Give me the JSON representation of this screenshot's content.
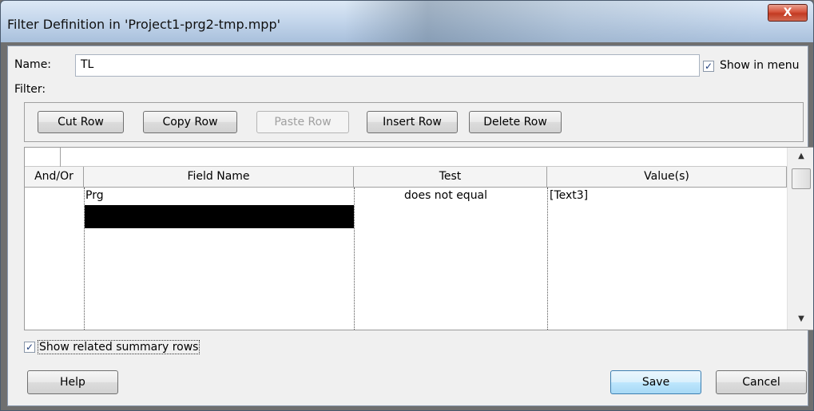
{
  "window": {
    "title": "Filter Definition in 'Project1-prg2-tmp.mpp'",
    "close_glyph": "X"
  },
  "name_field": {
    "label": "Name:",
    "value": "TL"
  },
  "show_in_menu": {
    "label": "Show in menu",
    "checked": true
  },
  "filter_label": "Filter:",
  "toolbar": {
    "cut_row": "Cut Row",
    "copy_row": "Copy Row",
    "paste_row": "Paste Row",
    "insert_row": "Insert Row",
    "delete_row": "Delete Row"
  },
  "grid": {
    "columns": [
      "And/Or",
      "Field Name",
      "Test",
      "Value(s)"
    ],
    "rows": [
      {
        "and_or": "",
        "field_name": "Prg",
        "test": "does not equal",
        "values": "[Text3]"
      }
    ]
  },
  "show_summary_rows": {
    "label": "Show related summary rows",
    "checked": true
  },
  "footer": {
    "help": "Help",
    "save": "Save",
    "cancel": "Cancel"
  },
  "icons": {
    "check": "✓",
    "scroll_up": "▲",
    "scroll_down": "▼"
  }
}
